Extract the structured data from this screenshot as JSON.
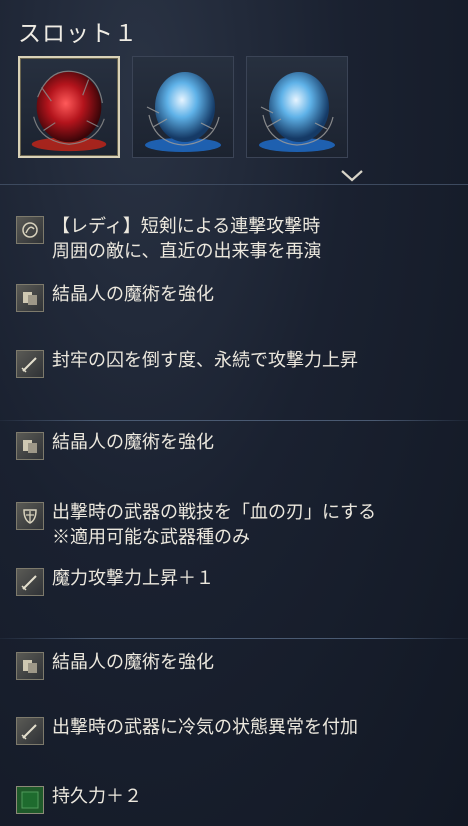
{
  "slot_title": "スロット１",
  "relics": [
    {
      "name": "red-relic",
      "color": "#c8202a",
      "selected": true
    },
    {
      "name": "blue-relic",
      "color": "#2a7fd0",
      "selected": false
    },
    {
      "name": "blue-relic",
      "color": "#2a7fd0",
      "selected": false
    }
  ],
  "effects": [
    {
      "icon": "character-emblem-icon",
      "lines": [
        "【レディ】短剣による連撃攻撃時",
        "周囲の敵に、直近の出来事を再演"
      ]
    },
    {
      "icon": "sorcery-icon",
      "lines": [
        "結晶人の魔術を強化"
      ]
    },
    {
      "icon": "sword-icon",
      "lines": [
        "封牢の囚を倒す度、永続で攻撃力上昇"
      ]
    },
    {
      "icon": "sorcery-icon",
      "lines": [
        "結晶人の魔術を強化"
      ]
    },
    {
      "icon": "weapon-skill-icon",
      "lines": [
        "出撃時の武器の戦技を「血の刃」にする",
        "※適用可能な武器種のみ"
      ]
    },
    {
      "icon": "sword-icon",
      "lines": [
        "魔力攻撃力上昇＋１"
      ]
    },
    {
      "icon": "sorcery-icon",
      "lines": [
        "結晶人の魔術を強化"
      ]
    },
    {
      "icon": "sword-icon",
      "lines": [
        "出撃時の武器に冷気の状態異常を付加"
      ]
    },
    {
      "icon": "stamina-icon",
      "lines": [
        "持久力＋２"
      ]
    }
  ]
}
